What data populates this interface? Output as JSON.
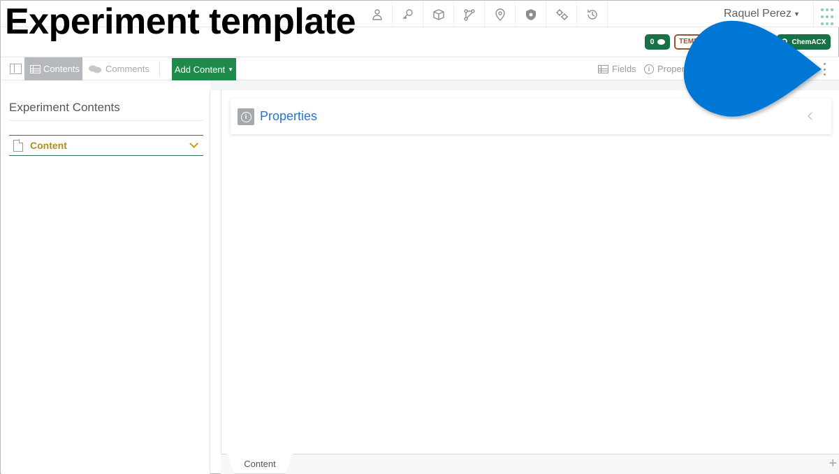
{
  "overlay": {
    "title": "Experiment template"
  },
  "header": {
    "nav_icons": [
      "person-icon",
      "key-icon",
      "cube-icon",
      "workflow-icon",
      "location-pin-icon",
      "shield-icon",
      "gears-icon",
      "history-icon"
    ],
    "user_name": "Raquel Perez",
    "apps_icon": "apps-grid-icon"
  },
  "badges": {
    "comments_count": "0",
    "template_label": "TEMPLATE",
    "chemacx_label": "ChemACX"
  },
  "toolbar": {
    "contents_label": "Contents",
    "comments_label": "Comments",
    "add_content_label": "Add Content",
    "fields_label": "Fields",
    "properties_label": "Properties"
  },
  "left_panel": {
    "title": "Experiment Contents",
    "section_label": "Content"
  },
  "main": {
    "properties_title": "Properties"
  },
  "bottom_tabs": [
    {
      "label": "Content"
    }
  ],
  "colors": {
    "green_button": "#1e8a4c",
    "badge_green": "#177245",
    "template_brown": "#a0522d",
    "link_blue": "#2c73c9",
    "section_gold": "#b08e1e",
    "callout_blue": "#0077d4"
  }
}
